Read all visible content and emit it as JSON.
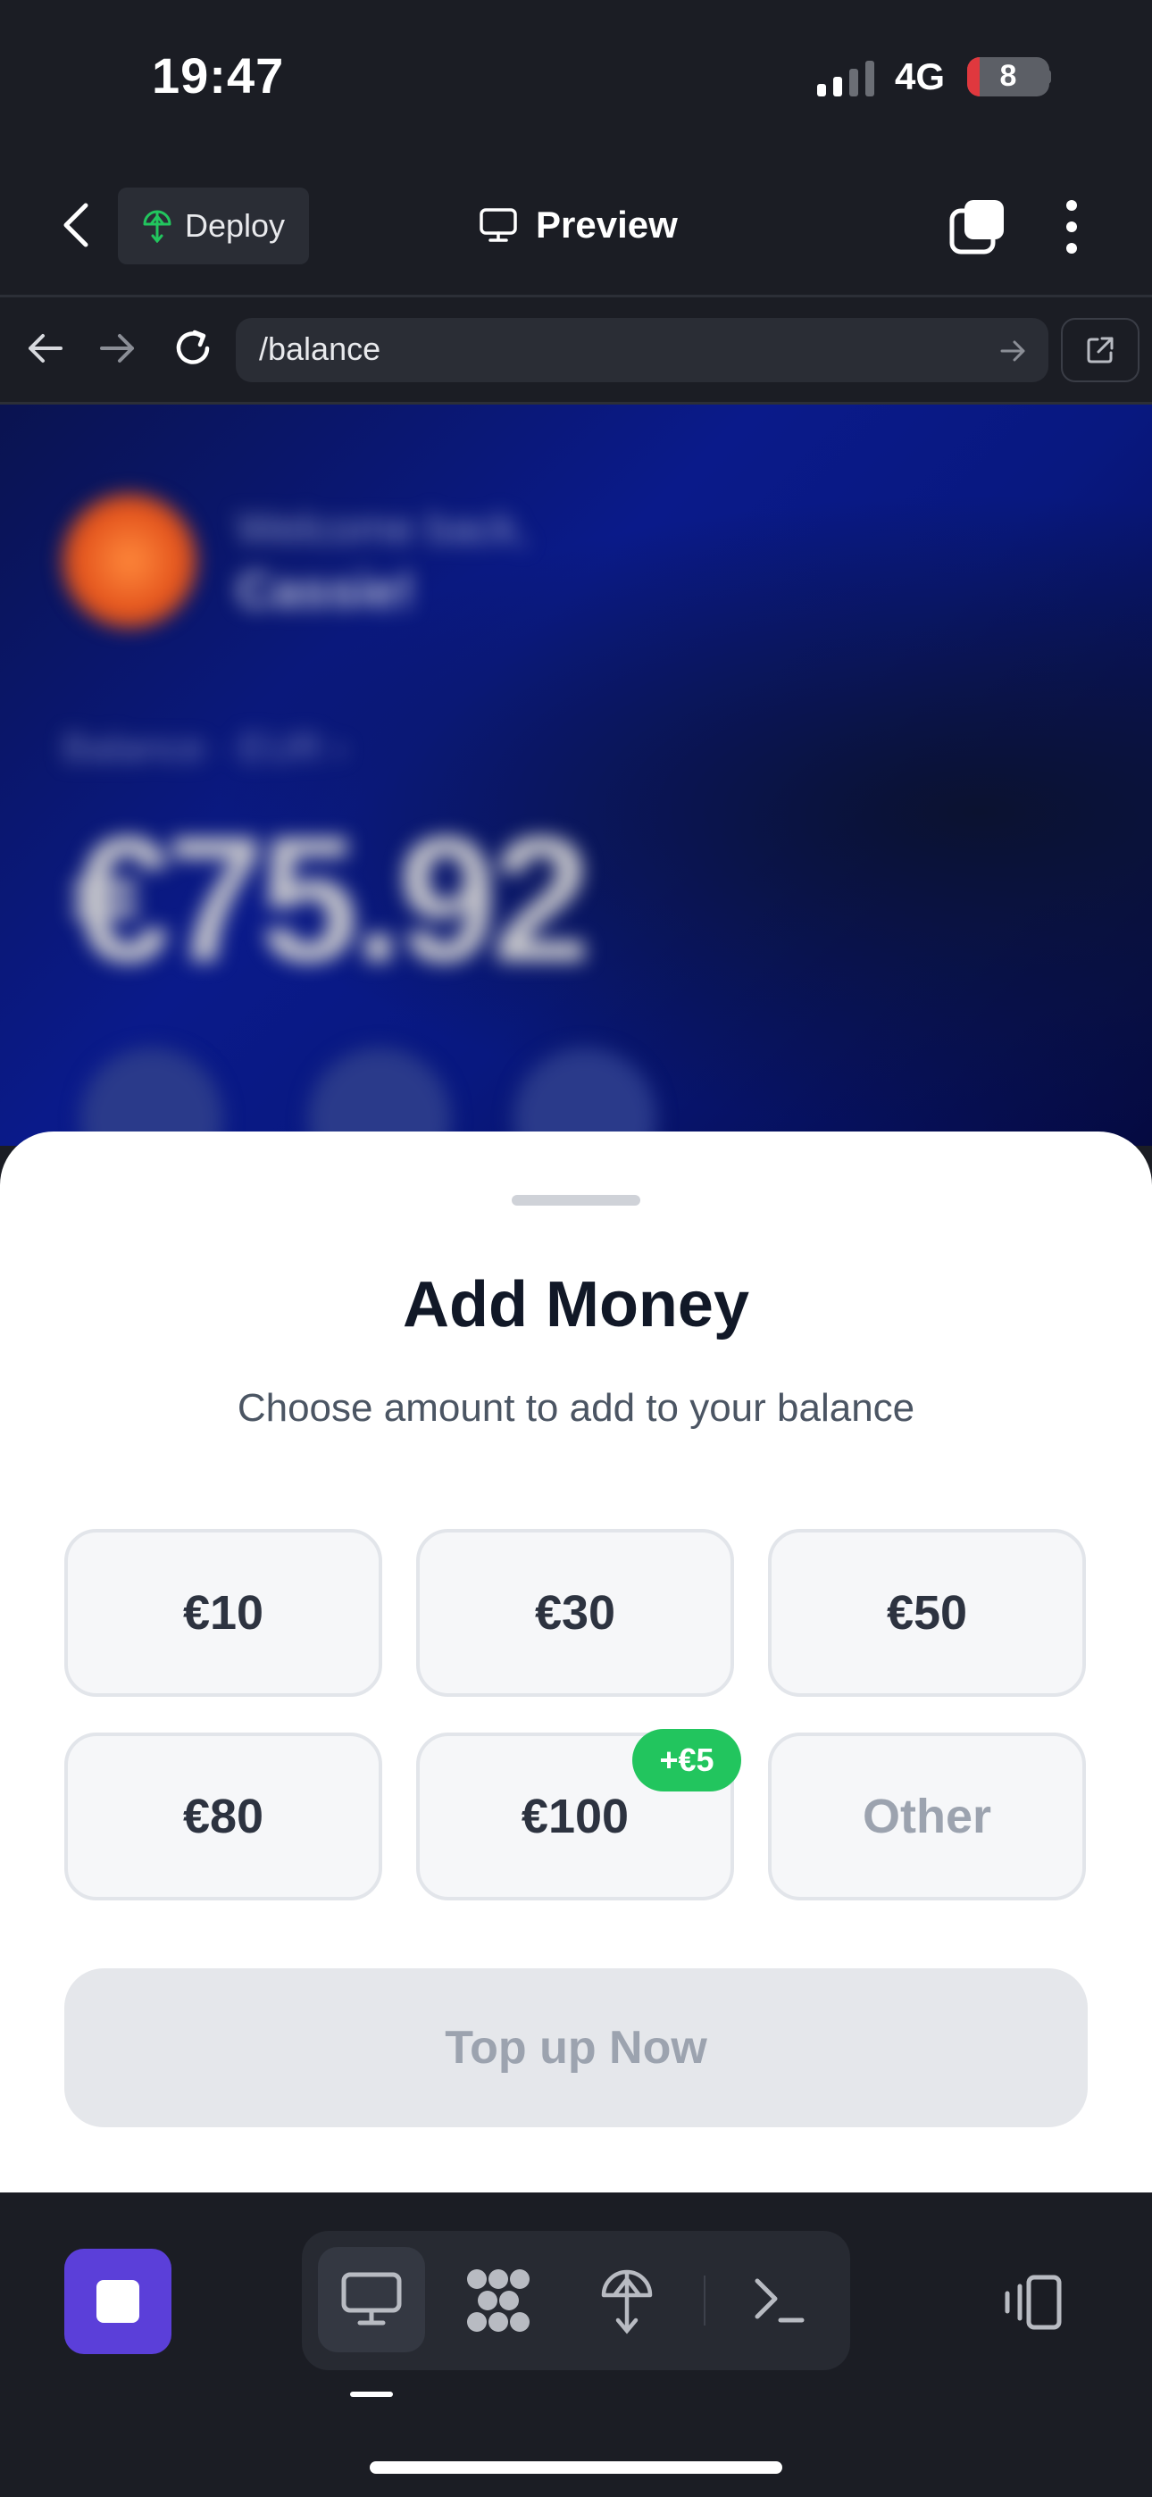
{
  "status_bar": {
    "time": "19:47",
    "network": "4G",
    "battery": "8"
  },
  "header": {
    "deploy_label": "Deploy",
    "preview_label": "Preview"
  },
  "browser": {
    "url": "/balance"
  },
  "background_page": {
    "welcome": "Welcome back,",
    "name": "Cassie!",
    "balance_label": "Balance  ·  EUR  ›",
    "balance_amount": "€75.92"
  },
  "sheet": {
    "title": "Add Money",
    "subtitle": "Choose amount to add to your balance",
    "amounts": [
      "€10",
      "€30",
      "€50",
      "€80",
      "€100",
      "Other"
    ],
    "bonus_badge": "+€5",
    "cta": "Top up Now"
  },
  "colors": {
    "accent": "#5b3fd9",
    "bonus": "#22c55e",
    "sheet_bg": "#ffffff",
    "app_bg": "#1b1d24"
  },
  "icons": [
    "back-icon",
    "deploy-icon",
    "monitor-icon",
    "tabs-icon",
    "more-icon",
    "arrow-left-icon",
    "arrow-right-icon",
    "reload-icon",
    "go-icon",
    "external-link-icon",
    "stop-icon",
    "dots-grid-icon",
    "terminal-icon",
    "device-toggle-icon"
  ]
}
